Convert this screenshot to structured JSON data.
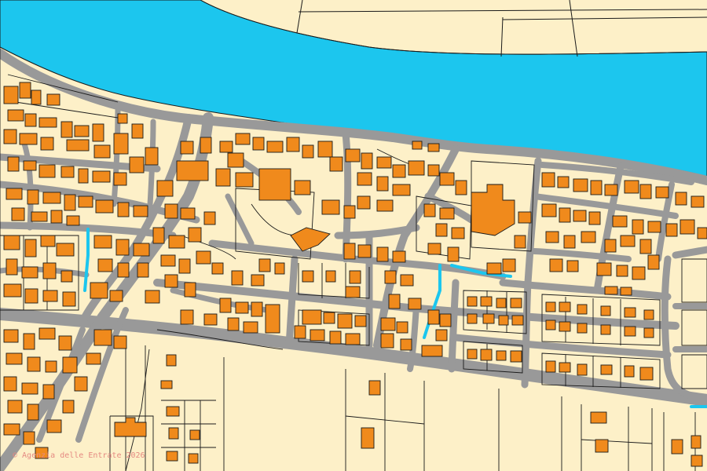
{
  "map": {
    "attribution": "© Agenzia delle Entrate 2026",
    "colors": {
      "land": "#fdf0c8",
      "water": "#1cc6ee",
      "road": "#999999",
      "building": "#f08a1c",
      "outline": "#1a1a1a"
    }
  }
}
